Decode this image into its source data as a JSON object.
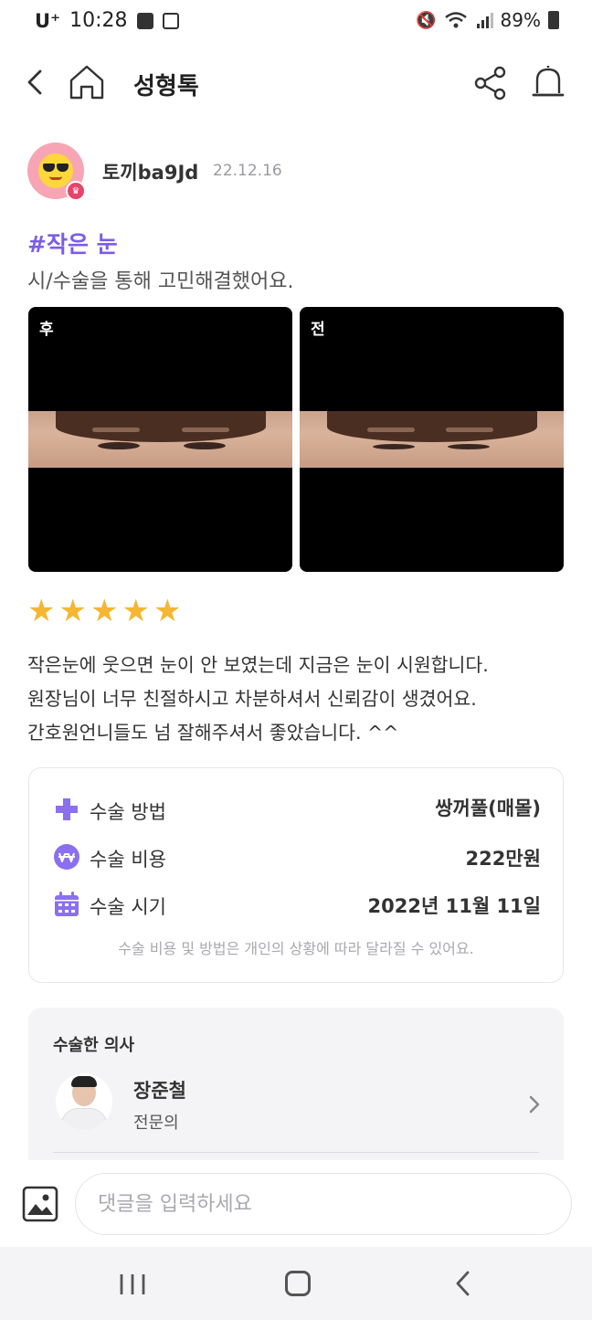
{
  "status_bar": {
    "carrier": "U⁺",
    "time": "10:28",
    "battery": "89%"
  },
  "header": {
    "title": "성형톡"
  },
  "post": {
    "author": "토끼ba9Jd",
    "date": "22.12.16",
    "hashtag": "#작은 눈",
    "subtitle": "시/수술을 통해 고민해결했어요.",
    "photos": [
      {
        "label": "후"
      },
      {
        "label": "전"
      }
    ],
    "rating": 5,
    "rating_max": 5,
    "review_lines": [
      "작은눈에 웃으면 눈이 안 보였는데 지금은 눈이 시원합니다.",
      "원장님이 너무 친절하시고 차분하셔서 신뢰감이 생겼어요.",
      "간호원언니들도 넘 잘해주셔서 좋았습니다.  ^^"
    ]
  },
  "surgery_info": {
    "rows": [
      {
        "label": "수술 방법",
        "value": "쌍꺼풀(매몰)",
        "icon": "plus-icon"
      },
      {
        "label": "수술 비용",
        "value": "222만원",
        "icon": "won-icon"
      },
      {
        "label": "수술 시기",
        "value": "2022년 11월 11일",
        "icon": "calendar-icon"
      }
    ],
    "note": "수술 비용 및 방법은 개인의 상황에 따라 달라질 수 있어요."
  },
  "doctor": {
    "heading": "수술한 의사",
    "name": "장준철",
    "role": "전문의"
  },
  "comment": {
    "placeholder": "댓글을 입력하세요"
  },
  "colors": {
    "accent": "#7c5ce8",
    "star": "#f5b731",
    "avatar_bg": "#f7a5b4"
  }
}
